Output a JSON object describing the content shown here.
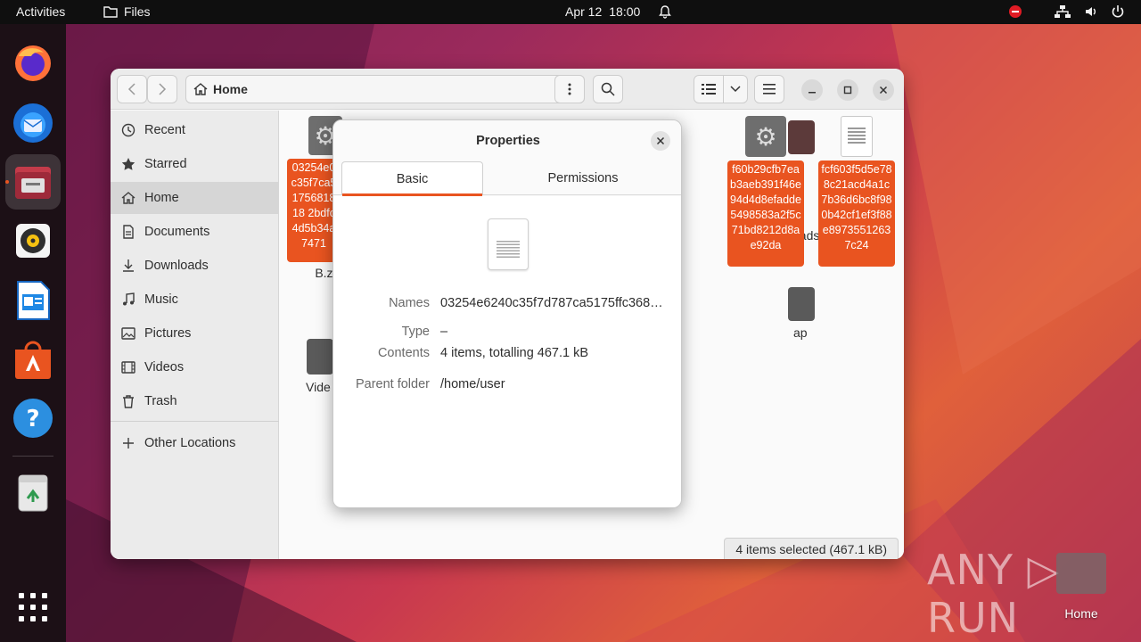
{
  "topbar": {
    "activities": "Activities",
    "app_name": "Files",
    "date": "Apr 12",
    "time": "18:00"
  },
  "dock": {
    "items": [
      "firefox-icon",
      "thunderbird-icon",
      "files-icon",
      "rhythmbox-icon",
      "libreoffice-writer-icon",
      "app-center-icon",
      "help-icon",
      "trash-icon"
    ]
  },
  "window": {
    "path": "Home",
    "sidebar": [
      {
        "label": "Recent",
        "icon": "clock-icon"
      },
      {
        "label": "Starred",
        "icon": "star-icon"
      },
      {
        "label": "Home",
        "icon": "home-icon"
      },
      {
        "label": "Documents",
        "icon": "document-icon"
      },
      {
        "label": "Downloads",
        "icon": "download-icon"
      },
      {
        "label": "Music",
        "icon": "music-icon"
      },
      {
        "label": "Pictures",
        "icon": "pictures-icon"
      },
      {
        "label": "Videos",
        "icon": "video-icon"
      },
      {
        "label": "Trash",
        "icon": "trash-icon"
      },
      {
        "label": "Other Locations",
        "icon": "plus-icon"
      }
    ],
    "files": {
      "f1_label": "03254e0c35f7ca5175681818 2bdfc4d5b34a7471",
      "f1_tail": "B.zi",
      "f2_label": "f60b29cfb7eab3aeb391f46e94d4d8efadde5498583a2f5c71bd8212d8ae92da",
      "f3_label": "fcf603f5d5e788c21acd4a1c7b36d6bc8f980b42cf1ef3f88e89735512637c24",
      "downloads_partial": "oads",
      "desktop_partial": "ap",
      "videos_partial": "Vide"
    },
    "status": "4 items selected  (467.1 kB)"
  },
  "dialog": {
    "title": "Properties",
    "tabs": {
      "basic": "Basic",
      "permissions": "Permissions"
    },
    "names_label": "Names",
    "names_value": "03254e6240c35f7d787ca5175ffc368…",
    "type_label": "Type",
    "type_value": "–",
    "contents_label": "Contents",
    "contents_value": "4 items, totalling 467.1 kB",
    "parent_label": "Parent folder",
    "parent_value": "/home/user"
  },
  "desktop": {
    "watermark": "ANY ▷ RUN",
    "home_label": "Home"
  },
  "colors": {
    "accent": "#e95420",
    "topbar": "#0f0f0f"
  }
}
